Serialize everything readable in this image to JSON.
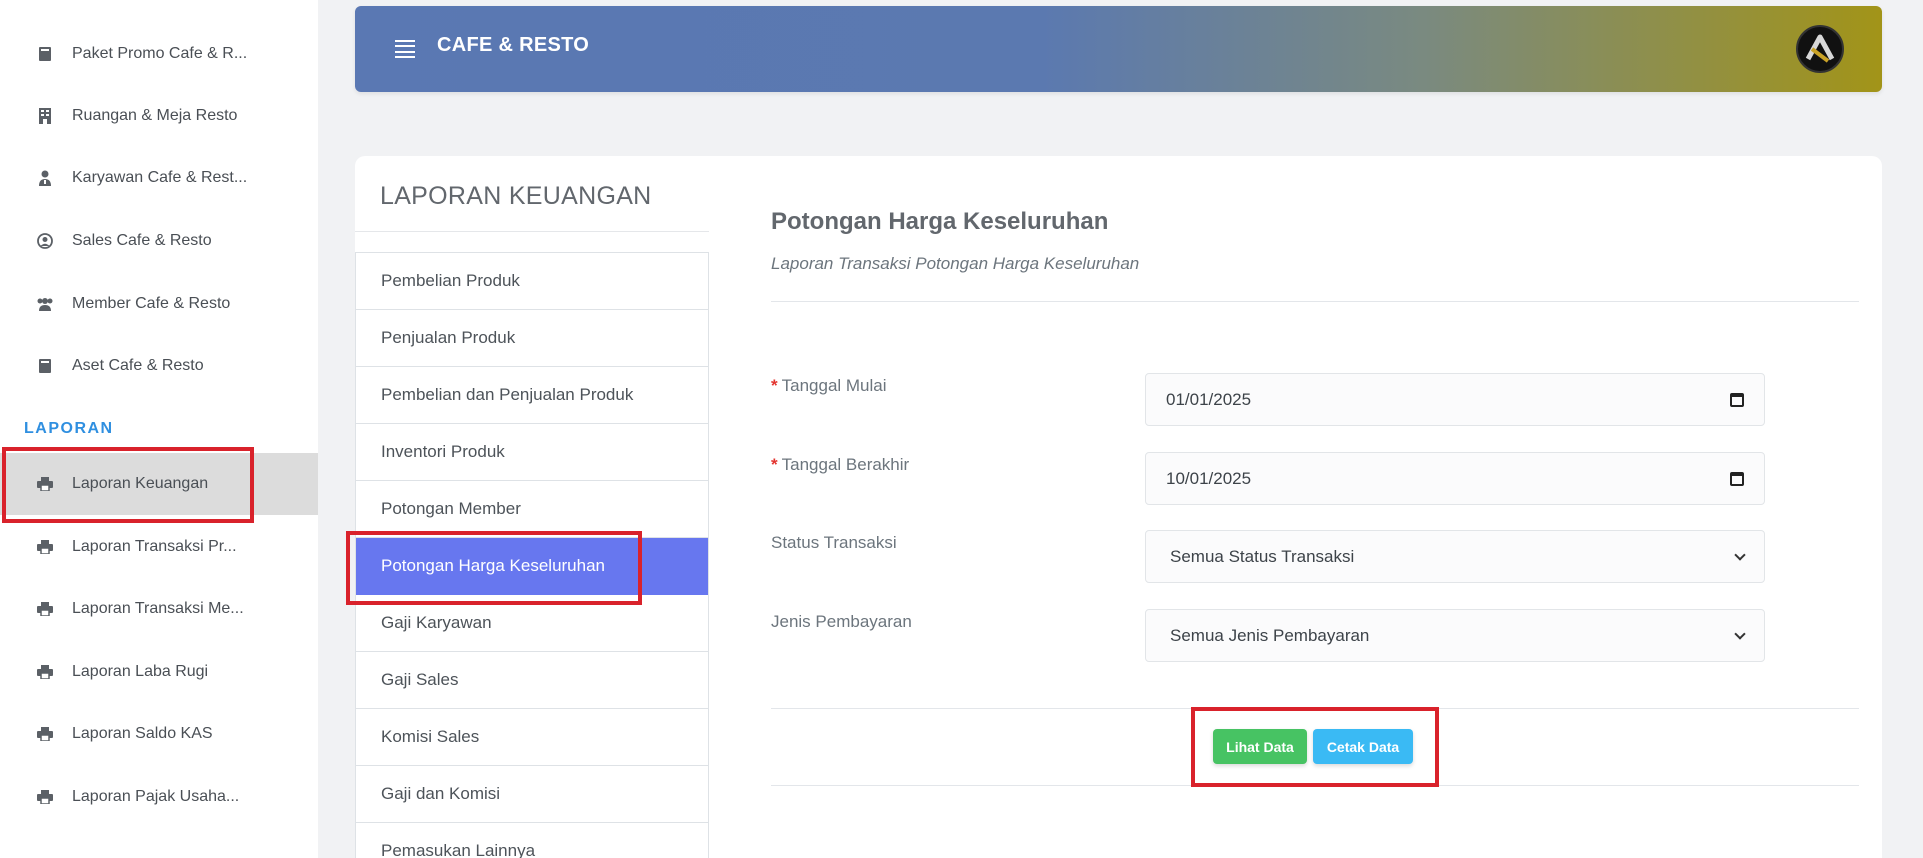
{
  "sidebar": {
    "items": [
      {
        "label": "Paket Promo Cafe & R...",
        "icon": "book-icon"
      },
      {
        "label": "Ruangan & Meja Resto",
        "icon": "building-icon"
      },
      {
        "label": "Karyawan Cafe & Rest...",
        "icon": "user-tie-icon"
      },
      {
        "label": "Sales Cafe & Resto",
        "icon": "user-circle-icon"
      },
      {
        "label": "Member Cafe & Resto",
        "icon": "users-icon"
      },
      {
        "label": "Aset Cafe & Resto",
        "icon": "book-icon"
      }
    ],
    "section_label": "LAPORAN",
    "report_items": [
      {
        "label": "Laporan Keuangan",
        "icon": "print-icon",
        "active": true
      },
      {
        "label": "Laporan Transaksi Pr...",
        "icon": "print-icon"
      },
      {
        "label": "Laporan Transaksi Me...",
        "icon": "print-icon"
      },
      {
        "label": "Laporan Laba Rugi",
        "icon": "print-icon"
      },
      {
        "label": "Laporan Saldo KAS",
        "icon": "print-icon"
      },
      {
        "label": "Laporan Pajak Usaha...",
        "icon": "print-icon"
      }
    ]
  },
  "header": {
    "title": "CAFE & RESTO"
  },
  "report_menu": {
    "title": "LAPORAN KEUANGAN",
    "items": [
      "Pembelian Produk",
      "Penjualan Produk",
      "Pembelian dan Penjualan Produk",
      "Inventori Produk",
      "Potongan Member",
      "Potongan Harga Keseluruhan",
      "Gaji Karyawan",
      "Gaji Sales",
      "Komisi Sales",
      "Gaji dan Komisi",
      "Pemasukan Lainnya"
    ],
    "active_index": 5
  },
  "form": {
    "title": "Potongan Harga Keseluruhan",
    "subtitle": "Laporan Transaksi Potongan Harga Keseluruhan",
    "required_mark": "*",
    "start_label": "Tanggal Mulai",
    "start_value": "01/01/2025",
    "end_label": "Tanggal Berakhir",
    "end_value": "10/01/2025",
    "status_label": "Status Transaksi",
    "status_value": "Semua Status Transaksi",
    "payment_label": "Jenis Pembayaran",
    "payment_value": "Semua Jenis Pembayaran",
    "view_button": "Lihat Data",
    "print_button": "Cetak Data"
  },
  "colors": {
    "accent": "#6777ef",
    "success": "#47c363",
    "info": "#3abaf4",
    "highlight": "#d9222b",
    "section": "#2f8fe0"
  }
}
